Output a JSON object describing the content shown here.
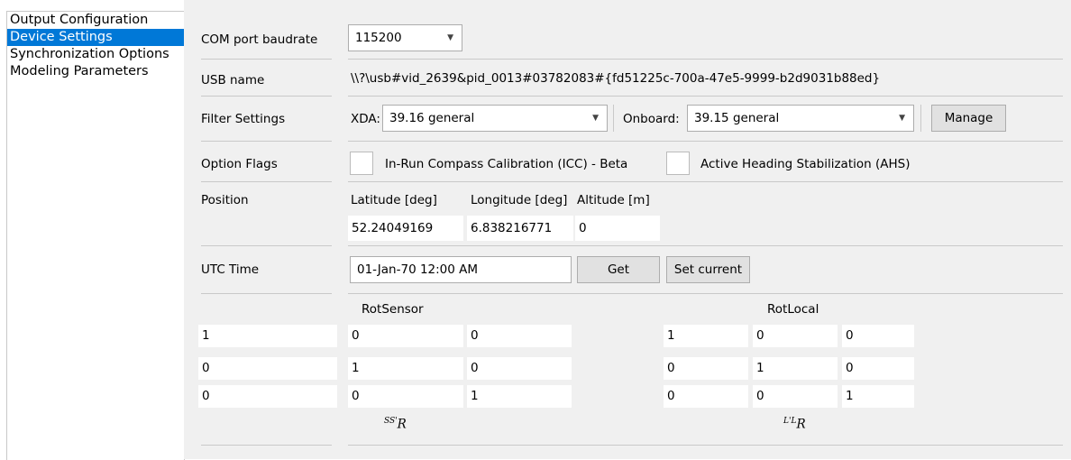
{
  "sidebar": {
    "items": [
      {
        "label": "Output Configuration"
      },
      {
        "label": "Device Settings"
      },
      {
        "label": "Synchronization Options"
      },
      {
        "label": "Modeling Parameters"
      }
    ]
  },
  "settings": {
    "com_port": {
      "label": "COM port baudrate",
      "value": "115200"
    },
    "usb": {
      "label": "USB name",
      "value": "\\\\?\\usb#vid_2639&pid_0013#03782083#{fd51225c-700a-47e5-9999-b2d9031b88ed}"
    },
    "filter": {
      "label": "Filter Settings",
      "xda_label": "XDA:",
      "xda_value": "39.16 general",
      "onboard_label": "Onboard:",
      "onboard_value": "39.15 general",
      "manage_button": "Manage"
    },
    "option_flags": {
      "label": "Option Flags",
      "icc_label": "In-Run Compass Calibration (ICC) - Beta",
      "ahs_label": "Active Heading Stabilization (AHS)"
    },
    "position": {
      "label": "Position",
      "lat_label": "Latitude [deg]",
      "lon_label": "Longitude [deg]",
      "alt_label": "Altitude [m]",
      "lat_value": "52.24049169",
      "lon_value": "6.838216771",
      "alt_value": "0"
    },
    "utc": {
      "label": "UTC Time",
      "value": "01-Jan-70 12:00 AM",
      "get_button": "Get",
      "set_button": "Set current"
    },
    "rotation": {
      "sensor_title": "RotSensor",
      "local_title": "RotLocal",
      "sensor_matrix": [
        [
          "1",
          "0",
          "0"
        ],
        [
          "0",
          "1",
          "0"
        ],
        [
          "0",
          "0",
          "1"
        ]
      ],
      "local_matrix": [
        [
          "1",
          "0",
          "0"
        ],
        [
          "0",
          "1",
          "0"
        ],
        [
          "0",
          "0",
          "1"
        ]
      ],
      "sensor_symbol_sup": "SS'",
      "local_symbol_sup": "L'L",
      "symbol_base": "R"
    }
  }
}
